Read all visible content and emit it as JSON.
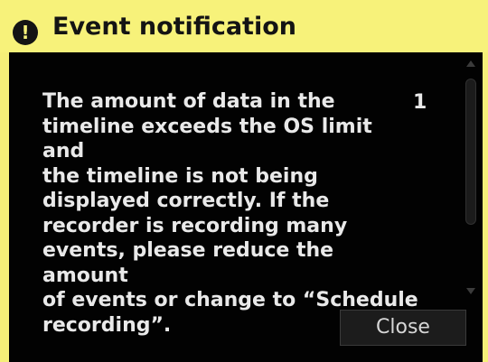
{
  "window": {
    "title": "Event notification",
    "title_icon": "exclamation-icon",
    "title_icon_glyph": "!",
    "accent_color": "#f7f27a",
    "panel_color": "#020202"
  },
  "notification": {
    "message": "The amount of data in the\ntimeline exceeds the OS limit and\nthe timeline is not being\ndisplayed correctly. If the\nrecorder is recording many\nevents, please reduce the amount\nof events or change to “Schedule\nrecording”.",
    "count": "1"
  },
  "actions": {
    "close_label": "Close"
  },
  "scrollbar": {
    "up_icon": "triangle-up-icon",
    "down_icon": "triangle-down-icon"
  }
}
